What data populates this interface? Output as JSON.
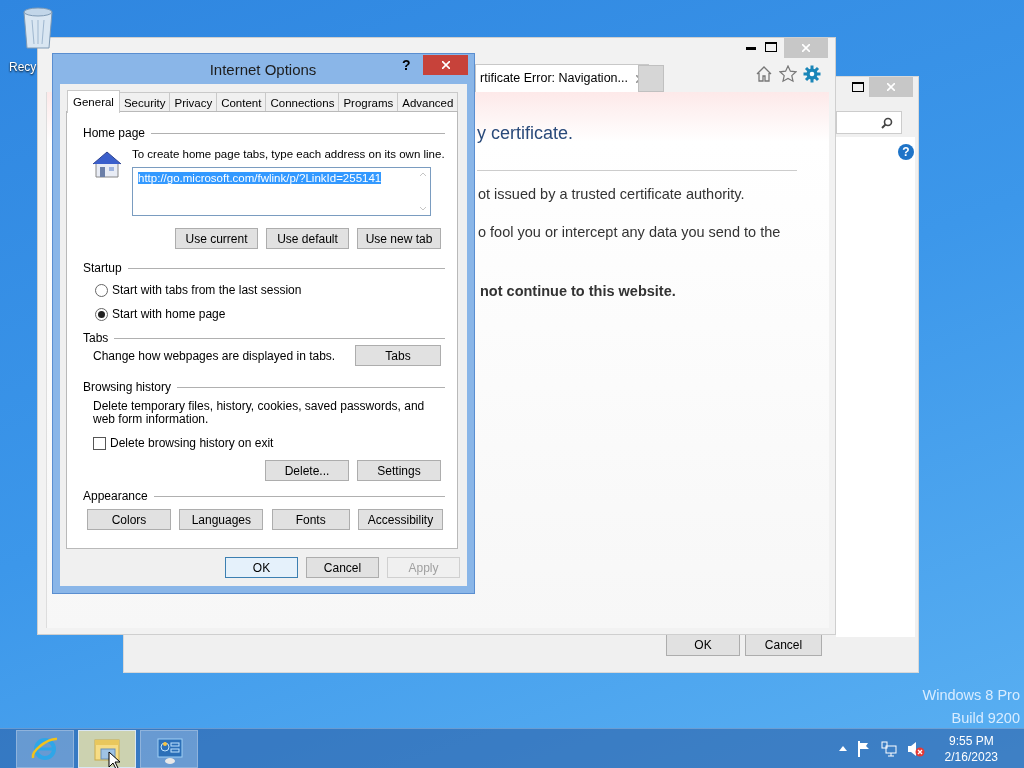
{
  "desktop": {
    "icons": [
      {
        "label": "Recy"
      }
    ],
    "edition": [
      "Windows 8 Pro",
      "Build 9200"
    ]
  },
  "back_window": {
    "help": "?",
    "buttons": [
      "OK",
      "Cancel"
    ]
  },
  "browser": {
    "tabs": [
      {
        "label": "rtificate Error: Navigation...",
        "selected": true
      }
    ],
    "page": {
      "heading": "y certificate.",
      "paragraphs": [
        "ot issued by a trusted certificate authority.",
        "o fool you or intercept any data you send to the"
      ],
      "warning": "not continue to this website."
    }
  },
  "dialog": {
    "title": "Internet Options",
    "help": "?",
    "tabs": [
      {
        "label": "General",
        "selected": true
      },
      {
        "label": "Security",
        "selected": false
      },
      {
        "label": "Privacy",
        "selected": false
      },
      {
        "label": "Content",
        "selected": false
      },
      {
        "label": "Connections",
        "selected": false
      },
      {
        "label": "Programs",
        "selected": false
      },
      {
        "label": "Advanced",
        "selected": false
      }
    ],
    "home_page": {
      "heading": "Home page",
      "instruction": "To create home page tabs, type each address on its own line.",
      "address": "http://go.microsoft.com/fwlink/p/?LinkId=255141",
      "buttons": [
        "Use current",
        "Use default",
        "Use new tab"
      ]
    },
    "startup": {
      "heading": "Startup",
      "options": [
        {
          "label": "Start with tabs from the last session",
          "selected": false
        },
        {
          "label": "Start with home page",
          "selected": true
        }
      ]
    },
    "tabs_group": {
      "heading": "Tabs",
      "description": "Change how webpages are displayed in tabs.",
      "button": "Tabs"
    },
    "browsing_history": {
      "heading": "Browsing history",
      "description": "Delete temporary files, history, cookies, saved passwords, and web form information.",
      "checkbox": {
        "label": "Delete browsing history on exit",
        "checked": false
      },
      "buttons": [
        "Delete...",
        "Settings"
      ]
    },
    "appearance": {
      "heading": "Appearance",
      "buttons": [
        "Colors",
        "Languages",
        "Fonts",
        "Accessibility"
      ]
    },
    "footer_buttons": [
      {
        "label": "OK",
        "default": true,
        "disabled": false
      },
      {
        "label": "Cancel",
        "default": false,
        "disabled": false
      },
      {
        "label": "Apply",
        "default": false,
        "disabled": true
      }
    ]
  },
  "taskbar": {
    "apps": [
      {
        "kind": "browser",
        "selected": false
      },
      {
        "kind": "folder",
        "selected": true
      },
      {
        "kind": "panel",
        "selected": false
      }
    ],
    "tray": {
      "time": "9:55 PM",
      "date": "2/16/2023"
    }
  }
}
